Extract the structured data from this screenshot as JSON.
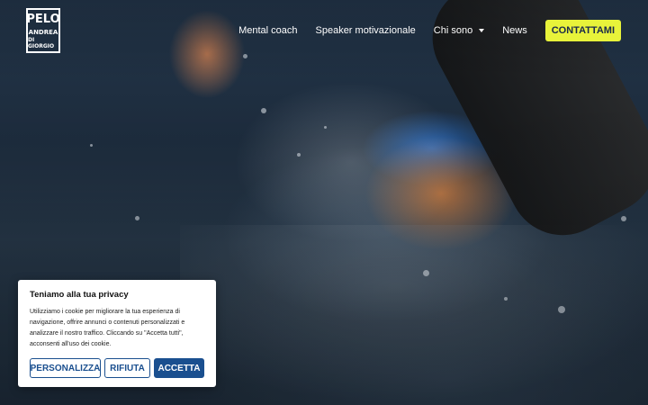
{
  "logo": {
    "line1": "PELO",
    "line2": "ANDREA",
    "line3": "DI GIORGIO"
  },
  "nav": {
    "items": [
      {
        "label": "Mental coach"
      },
      {
        "label": "Speaker motivazionale"
      },
      {
        "label": "Chi sono"
      },
      {
        "label": "News"
      }
    ],
    "cta_label": "CONTATTAMI"
  },
  "cookie_banner": {
    "title": "Teniamo alla tua privacy",
    "body": "Utilizziamo i cookie per migliorare la tua esperienza di navigazione, offrire annunci o contenuti personalizzati e analizzare il nostro traffico. Cliccando su \"Accetta tutti\", acconsenti all'uso dei cookie.",
    "buttons": {
      "customize": "PERSONALIZZA",
      "reject": "RIFIUTA",
      "accept": "ACCETTA"
    }
  },
  "colors": {
    "accent": "#e8f33a",
    "primary_blue": "#1a4f8f"
  },
  "icons": {
    "dropdown": "chevron-down-icon"
  }
}
